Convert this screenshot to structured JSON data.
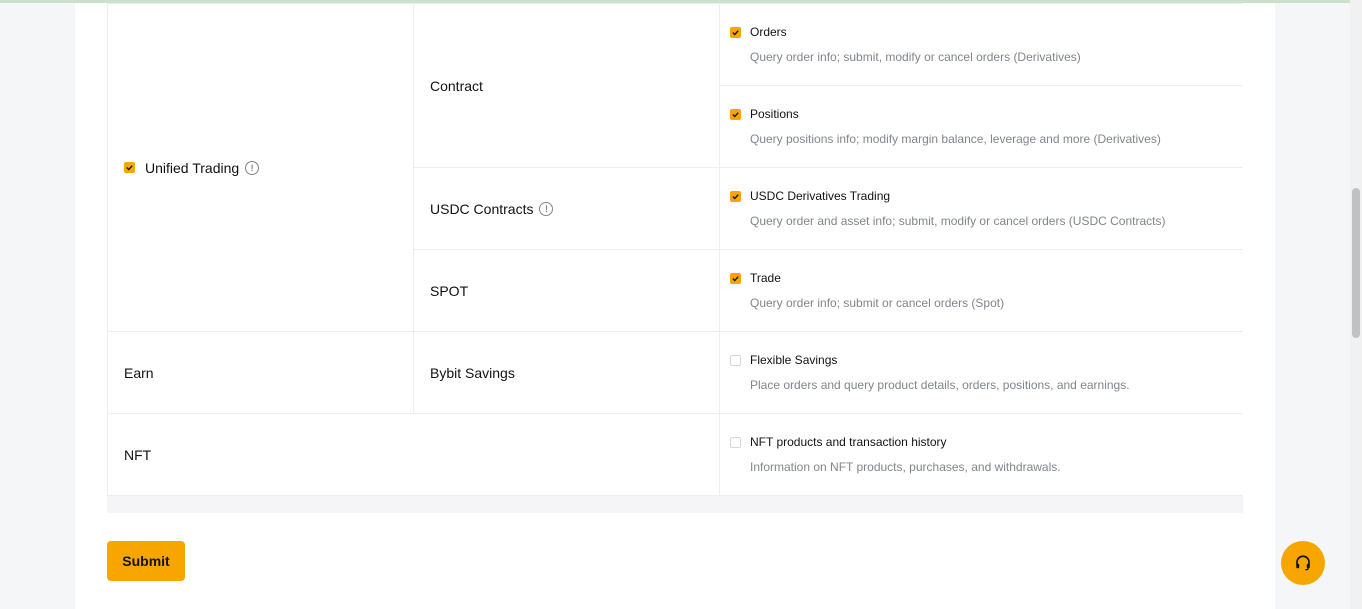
{
  "table": {
    "unified_trading": {
      "label": "Unified Trading",
      "checked": true,
      "contract": {
        "label": "Contract",
        "orders": {
          "title": "Orders",
          "desc": "Query order info; submit, modify or cancel orders (Derivatives)",
          "checked": true
        },
        "positions": {
          "title": "Positions",
          "desc": "Query positions info; modify margin balance, leverage and more (Derivatives)",
          "checked": true
        }
      },
      "usdc": {
        "label": "USDC Contracts",
        "trading": {
          "title": "USDC Derivatives Trading",
          "desc": "Query order and asset info; submit, modify or cancel orders (USDC Contracts)",
          "checked": true
        }
      },
      "spot": {
        "label": "SPOT",
        "trade": {
          "title": "Trade",
          "desc": "Query order info; submit or cancel orders (Spot)",
          "checked": true
        }
      }
    },
    "earn": {
      "label": "Earn",
      "savings_label": "Bybit Savings",
      "flexible": {
        "title": "Flexible Savings",
        "desc": "Place orders and query product details, orders, positions, and earnings.",
        "checked": false
      }
    },
    "nft": {
      "label": "NFT",
      "products": {
        "title": "NFT products and transaction history",
        "desc": "Information on NFT products, purchases, and withdrawals.",
        "checked": false
      }
    }
  },
  "submit_label": "Submit",
  "colors": {
    "accent": "#f7a600",
    "border": "#eceef1",
    "muted": "#81858c"
  },
  "icons": {
    "info": "info-icon",
    "check": "check-icon",
    "support": "headset-icon"
  }
}
